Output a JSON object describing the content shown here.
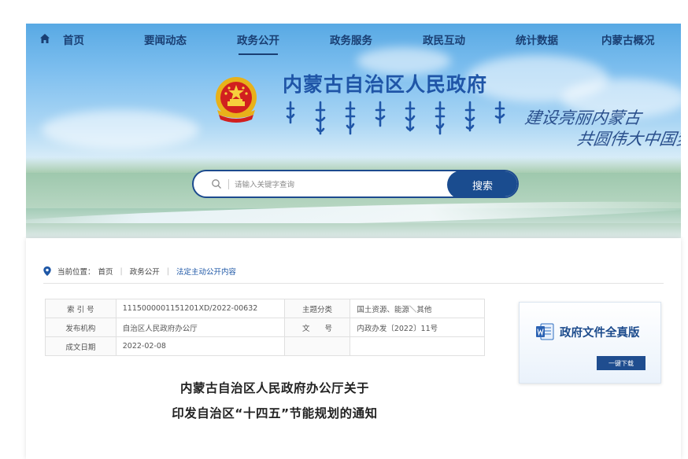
{
  "nav": {
    "items": [
      {
        "label": "首页"
      },
      {
        "label": "要闻动态"
      },
      {
        "label": "政务公开"
      },
      {
        "label": "政务服务"
      },
      {
        "label": "政民互动"
      },
      {
        "label": "统计数据"
      },
      {
        "label": "内蒙古概况"
      }
    ],
    "active": "政务公开"
  },
  "banner": {
    "site_title": "内蒙古自治区人民政府",
    "slogan_line1": "建设亮丽内蒙古",
    "slogan_line2": "共圆伟大中国梦"
  },
  "search": {
    "placeholder": "请输入关键字查询",
    "button_label": "搜索"
  },
  "breadcrumb": {
    "prefix": "当前位置：",
    "items": [
      "首页",
      "政务公开",
      "法定主动公开内容"
    ]
  },
  "meta": {
    "rows": [
      {
        "label1": "索 引 号",
        "value1": "11150000011512​01XD/2022-00632",
        "label2": "主题分类",
        "value2": "国土资源、能源＼其他"
      },
      {
        "label1": "发布机构",
        "value1": "自治区人民政府办公厅",
        "label2": "文　　号",
        "value2": "内政办发〔2022〕11号"
      },
      {
        "label1": "成文日期",
        "value1": "2022-02-08",
        "label2": "",
        "value2": ""
      }
    ]
  },
  "side_widget": {
    "title": "政府文件全真版",
    "button_label": "一键下载"
  },
  "document": {
    "title_line1": "内蒙古自治区人民政府办公厅关于",
    "title_line2": "印发自治区“十四五”节能规划的通知"
  },
  "colors": {
    "nav_text": "#1a3f73",
    "brand_blue": "#1a4c8f",
    "title_blue": "#1f55a7",
    "link_blue": "#1e57a6"
  }
}
